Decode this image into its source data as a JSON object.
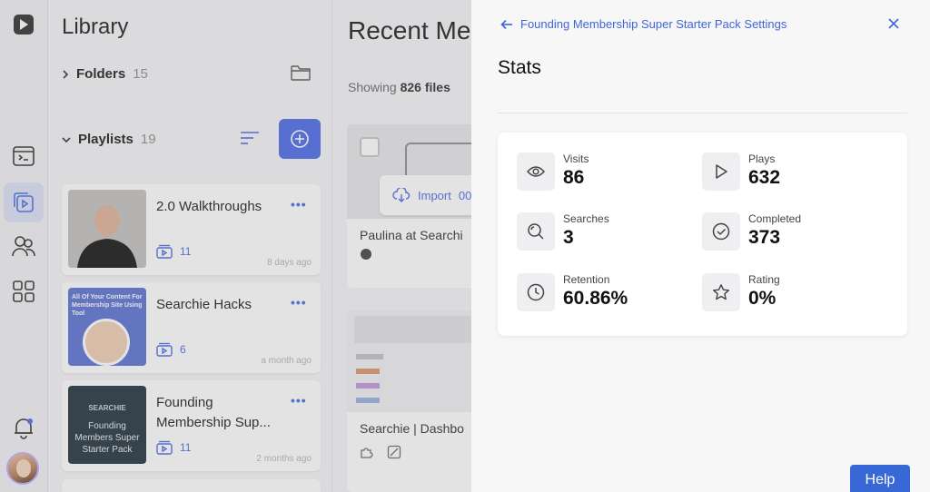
{
  "library": {
    "title": "Library",
    "folders": {
      "label": "Folders",
      "count": "15"
    },
    "playlists": {
      "label": "Playlists",
      "count": "19"
    },
    "cards": [
      {
        "title": "2.0 Walkthroughs",
        "count": "11",
        "time": "8 days ago"
      },
      {
        "title": "Searchie Hacks",
        "count": "6",
        "time": "a month ago",
        "thumb_text": "All Of Your Content For Membership Site Using Tool"
      },
      {
        "title": "Founding Membership Sup...",
        "count": "11",
        "time": "2 months ago",
        "thumb_brand": "SEARCHIE",
        "thumb_text": "Founding Members Super Starter Pack"
      }
    ]
  },
  "recent": {
    "title": "Recent Me",
    "showing_prefix": "Showing",
    "showing_count": "826 files",
    "import_label": "Import",
    "import_count": "00",
    "card1_title": "Paulina at Searchi",
    "card2_title": "Searchie | Dashbo"
  },
  "panel": {
    "back_label": "Founding Membership Super Starter Pack Settings",
    "title": "Stats",
    "stats": [
      {
        "label": "Visits",
        "value": "86",
        "icon": "eye-icon"
      },
      {
        "label": "Plays",
        "value": "632",
        "icon": "play-icon"
      },
      {
        "label": "Searches",
        "value": "3",
        "icon": "search-icon"
      },
      {
        "label": "Completed",
        "value": "373",
        "icon": "check-circle-icon"
      },
      {
        "label": "Retention",
        "value": "60.86%",
        "icon": "clock-icon"
      },
      {
        "label": "Rating",
        "value": "0%",
        "icon": "star-icon"
      }
    ]
  },
  "help_label": "Help",
  "colors": {
    "accent": "#3f66d8",
    "button": "#5b79e8",
    "help": "#3868d6"
  }
}
